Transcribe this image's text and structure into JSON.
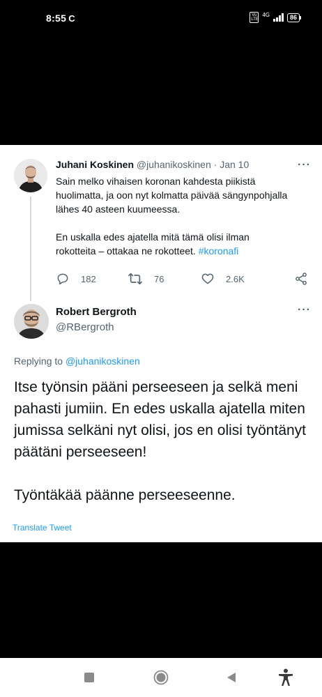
{
  "status_bar": {
    "time": "8:55",
    "notification_glyph": "C",
    "volte": "Vo LTE",
    "network": "4G",
    "battery": "86"
  },
  "tweet1": {
    "name": "Juhani Koskinen",
    "handle": "@juhanikoskinen",
    "separator": "·",
    "date": "Jan 10",
    "more": "···",
    "paragraph1": "Sain melko vihaisen koronan kahdesta piikistä huolimatta, ja oon nyt kolmatta päivää sängynpohjalla lähes 40 asteen kuumeessa.",
    "paragraph2_text": "En uskalla edes ajatella mitä tämä olisi ilman rokotteita – ottakaa ne rokotteet.",
    "hashtag": "#koronafi",
    "replies": "182",
    "retweets": "76",
    "likes": "2.6K"
  },
  "tweet2": {
    "name": "Robert Bergroth",
    "handle": "@RBergroth",
    "more": "···",
    "replying_prefix": "Replying to",
    "replying_handle": "@juhanikoskinen",
    "paragraph1": "Itse työnsin pääni perseeseen ja selkä meni pahasti jumiin. En edes uskalla ajatella miten jumissa selkäni nyt olisi, jos en olisi työntänyt päätäni perseeseen!",
    "paragraph2": "Työntäkää päänne perseeseenne.",
    "translate": "Translate Tweet"
  },
  "icons": {
    "status": [
      "volte-icon",
      "signal-icon",
      "battery-icon"
    ],
    "tweet_actions": [
      "reply-icon",
      "retweet-icon",
      "like-icon",
      "share-icon"
    ],
    "nav": [
      "recents-icon",
      "home-icon",
      "back-icon",
      "accessibility-icon"
    ]
  },
  "colors": {
    "link": "#1d9bf0",
    "muted": "#536471",
    "text": "#0f1419",
    "background": "#000000"
  }
}
